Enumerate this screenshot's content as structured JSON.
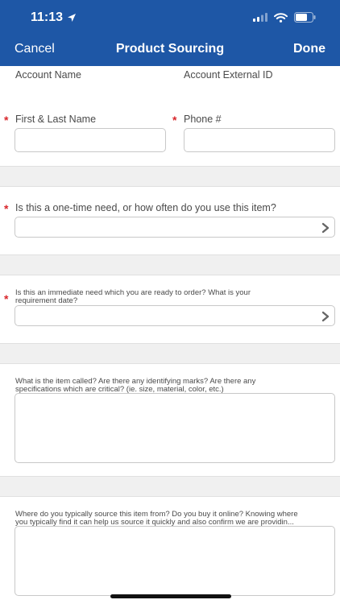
{
  "status_bar": {
    "time": "11:13"
  },
  "nav": {
    "cancel_label": "Cancel",
    "title": "Product Sourcing",
    "done_label": "Done"
  },
  "fields": {
    "account_name_label": "Account Name",
    "account_external_id_label": "Account External ID",
    "first_last_name_label": "First & Last Name",
    "phone_label": "Phone #",
    "frequency_label": "Is this a one-time need, or how often do you use this item?",
    "immediate_need_label_line1": "Is this an immediate need which you are ready to order? What is your",
    "immediate_need_label_line2": "requirement date?",
    "item_called_label_line1": "What is the item called? Are there any identifying marks? Are there any",
    "item_called_label_line2": "specifications which are critical? (ie. size, material, color, etc.)",
    "source_label_line1": "Where do you typically source this item from? Do you buy it online? Knowing where",
    "source_label_line2": "you typically find it can help us source it quickly and also confirm we are providin..."
  },
  "required_marker": "*",
  "colors": {
    "header": "#1e57a6",
    "required": "#d8262b",
    "band": "#f0f0f0"
  }
}
